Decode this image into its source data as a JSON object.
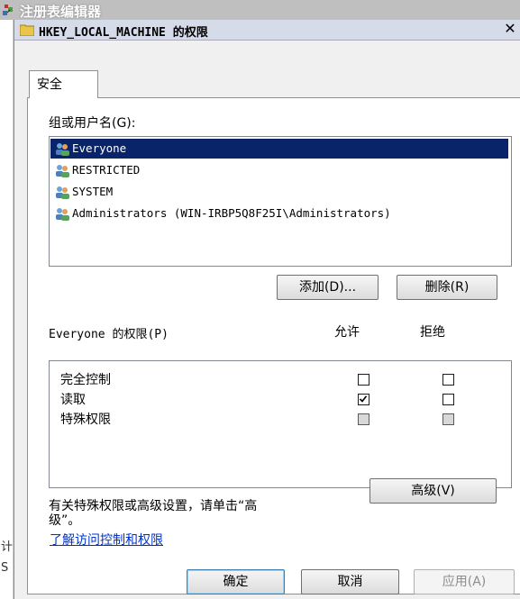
{
  "parent_window": {
    "title": "注册表编辑器",
    "left_fragments": [
      "计",
      "S"
    ]
  },
  "dialog": {
    "title": "HKEY_LOCAL_MACHINE 的权限",
    "close_glyph": "✕",
    "tab_label": "安全",
    "group_label": "组或用户名(G):",
    "users": [
      {
        "name": "Everyone",
        "selected": true
      },
      {
        "name": "RESTRICTED",
        "selected": false
      },
      {
        "name": "SYSTEM",
        "selected": false
      },
      {
        "name": "Administrators (WIN-IRBP5Q8F25I\\Administrators)",
        "selected": false
      }
    ],
    "add_button": "添加(D)...",
    "remove_button": "删除(R)",
    "perm_header": "Everyone 的权限(P)",
    "allow_header": "允许",
    "deny_header": "拒绝",
    "permissions": [
      {
        "name": "完全控制",
        "allow": "unchecked",
        "deny": "unchecked"
      },
      {
        "name": "读取",
        "allow": "checked",
        "deny": "unchecked"
      },
      {
        "name": "特殊权限",
        "allow": "grayed",
        "deny": "grayed"
      }
    ],
    "advanced_hint": "有关特殊权限或高级设置，请单击“高级”。",
    "advanced_hint_line1": "有关特殊权限或高级设置，请单击“高",
    "advanced_hint_line2": "级”。",
    "advanced_button": "高级(V)",
    "learn_link": "了解访问控制和权限",
    "ok_button": "确定",
    "cancel_button": "取消",
    "apply_button": "应用(A)"
  },
  "colors": {
    "selection": "#0a246a",
    "link": "#0033cc",
    "title_bg": "#d6dbe9"
  }
}
